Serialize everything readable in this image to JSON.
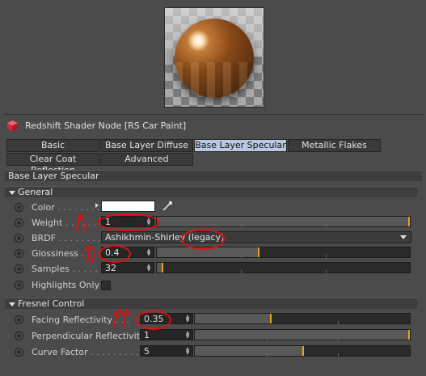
{
  "node_title": "Redshift Shader Node [RS Car Paint]",
  "tabs_row1": [
    "Basic",
    "Base Layer Diffuse",
    "Base Layer Specular",
    "Metallic Flakes"
  ],
  "tabs_row2": [
    "Clear Coat Reflection",
    "Advanced"
  ],
  "active_tab": "Base Layer Specular",
  "panel_title": "Base Layer Specular",
  "general": {
    "header": "General",
    "color_label": "Color",
    "color_value": "#ffffff",
    "weight_label": "Weight",
    "weight_value": "1",
    "weight_fraction": 1.0,
    "brdf_label": "BRDF",
    "brdf_value": "Ashikhmin-Shirley (legacy)",
    "glossiness_label": "Glossiness",
    "glossiness_value": "0.4",
    "glossiness_fraction": 0.4,
    "samples_label": "Samples",
    "samples_value": "32",
    "samples_fraction": 0.02,
    "highlights_label": "Highlights Only"
  },
  "fresnel": {
    "header": "Fresnel Control",
    "facing_label": "Facing Reflectivity",
    "facing_value": "0.35",
    "facing_fraction": 0.35,
    "perp_label": "Perpendicular Reflectivity",
    "perp_value": "1",
    "perp_fraction": 1.0,
    "curve_label": "Curve Factor",
    "curve_value": "5",
    "curve_fraction": 0.5
  },
  "colors": {
    "background": "#4b4b4b",
    "active_tab": "#b9c9e2",
    "slider_knob": "#e2a322",
    "annotation": "#e01010"
  }
}
